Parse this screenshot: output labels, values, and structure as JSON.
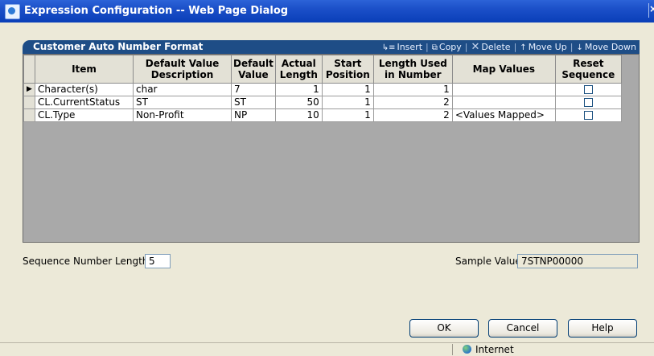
{
  "window": {
    "title": "Expression Configuration -- Web Page Dialog"
  },
  "panel": {
    "title": "Customer Auto Number Format",
    "toolbar": {
      "insert": "Insert",
      "copy": "Copy",
      "delete": "Delete",
      "move_up": "Move Up",
      "move_down": "Move Down",
      "separator": "|"
    }
  },
  "grid": {
    "columns": [
      "Item",
      "Default Value Description",
      "Default Value",
      "Actual Length",
      "Start Position",
      "Length Used in Number",
      "Map Values",
      "Reset Sequence"
    ],
    "row_indicator": "▶",
    "rows": [
      {
        "item": "Character(s)",
        "description": "char",
        "default_value": "7",
        "actual_length": "1",
        "start_position": "1",
        "length_used": "1",
        "map_values": "",
        "reset_sequence": false
      },
      {
        "item": "CL.CurrentStatus",
        "description": "ST",
        "default_value": "ST",
        "actual_length": "50",
        "start_position": "1",
        "length_used": "2",
        "map_values": "",
        "reset_sequence": false
      },
      {
        "item": "CL.Type",
        "description": "Non-Profit",
        "default_value": "NP",
        "actual_length": "10",
        "start_position": "1",
        "length_used": "2",
        "map_values": "<Values Mapped>",
        "reset_sequence": false
      }
    ]
  },
  "sequence": {
    "label": "Sequence Number Length",
    "value": "5"
  },
  "sample": {
    "label": "Sample Value",
    "value": "7STNP00000"
  },
  "buttons": {
    "ok": "OK",
    "cancel": "Cancel",
    "help": "Help"
  },
  "status_bar": {
    "zone": "Internet"
  },
  "colors": {
    "panel_header": "#1e4d86",
    "title_bar": "#1b4fc8",
    "dialog_bg": "#ece9d8"
  }
}
